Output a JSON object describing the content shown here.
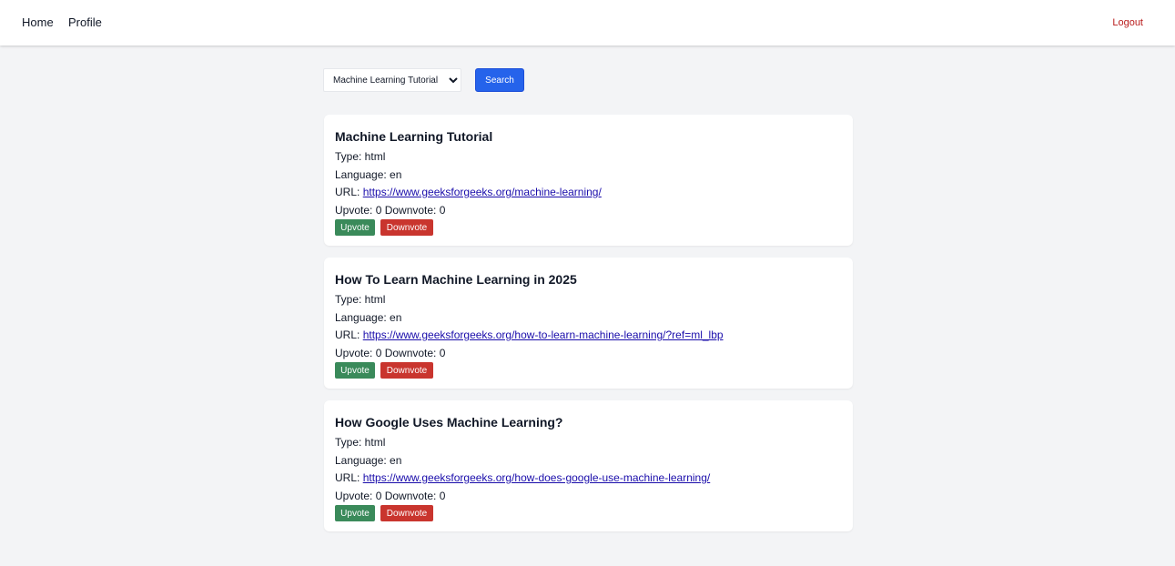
{
  "navbar": {
    "home": "Home",
    "profile": "Profile",
    "logout": "Logout"
  },
  "search": {
    "selected": "Machine Learning Tutorial",
    "button": "Search"
  },
  "colors": {
    "accent": "#2563eb",
    "upvote": "#3a8a5a",
    "downvote": "#c9352e",
    "logout": "#b91c1c",
    "link": "#1a0dab"
  },
  "results": [
    {
      "title": "Machine Learning Tutorial",
      "type": "Type: html",
      "language": "Language: en",
      "url_label": "URL: ",
      "url": "https://www.geeksforgeeks.org/machine-learning/",
      "votes": "Upvote: 0 Downvote: 0",
      "upvote": "Upvote",
      "downvote": "Downvote"
    },
    {
      "title": "How To Learn Machine Learning in 2025",
      "type": "Type: html",
      "language": "Language: en",
      "url_label": "URL: ",
      "url": "https://www.geeksforgeeks.org/how-to-learn-machine-learning/?ref=ml_lbp",
      "votes": "Upvote: 0 Downvote: 0",
      "upvote": "Upvote",
      "downvote": "Downvote"
    },
    {
      "title": "How Google Uses Machine Learning?",
      "type": "Type: html",
      "language": "Language: en",
      "url_label": "URL: ",
      "url": "https://www.geeksforgeeks.org/how-does-google-use-machine-learning/",
      "votes": "Upvote: 0 Downvote: 0",
      "upvote": "Upvote",
      "downvote": "Downvote"
    }
  ]
}
